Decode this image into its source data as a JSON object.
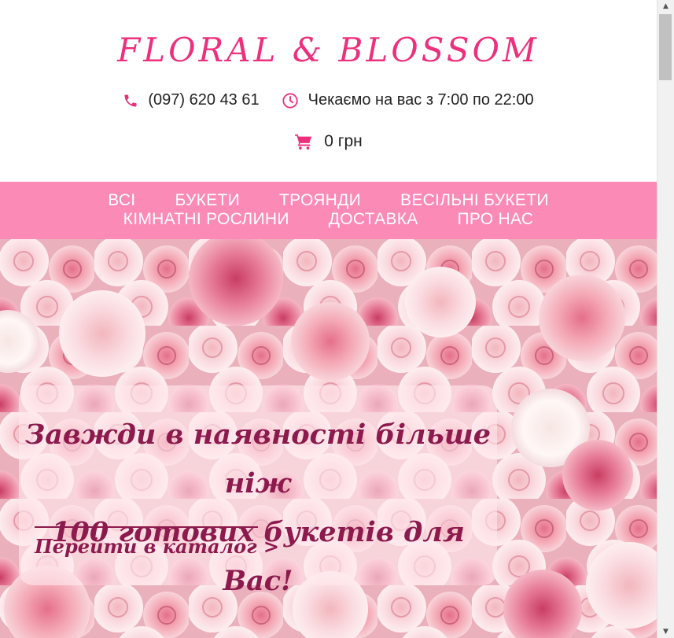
{
  "brand": {
    "logo": "FLORAL & BLOSSOM",
    "accent_color": "#ee2f7c",
    "nav_color": "#fb8bb6",
    "hero_text_color": "#8c1a4d"
  },
  "header": {
    "phone": "(097) 620 43 61",
    "phone_icon": "phone-icon",
    "hours": "Чекаємо на вас з 7:00 по 22:00",
    "hours_icon": "clock-icon",
    "cart_total": "0 грн",
    "cart_icon": "cart-icon"
  },
  "nav": {
    "items": [
      {
        "label": "ВСІ"
      },
      {
        "label": "БУКЕТИ"
      },
      {
        "label": "ТРОЯНДИ"
      },
      {
        "label": "ВЕСІЛЬНІ БУКЕТИ"
      },
      {
        "label": "КІМНАТНІ РОСЛИНИ"
      },
      {
        "label": "ДОСТАВКА"
      },
      {
        "label": "ПРО НАС"
      }
    ]
  },
  "hero": {
    "title_line1": "Завжди в наявності більше ніж",
    "title_line2": "100 готових букетів для Вас!",
    "cta": "Перейти в каталог >"
  }
}
